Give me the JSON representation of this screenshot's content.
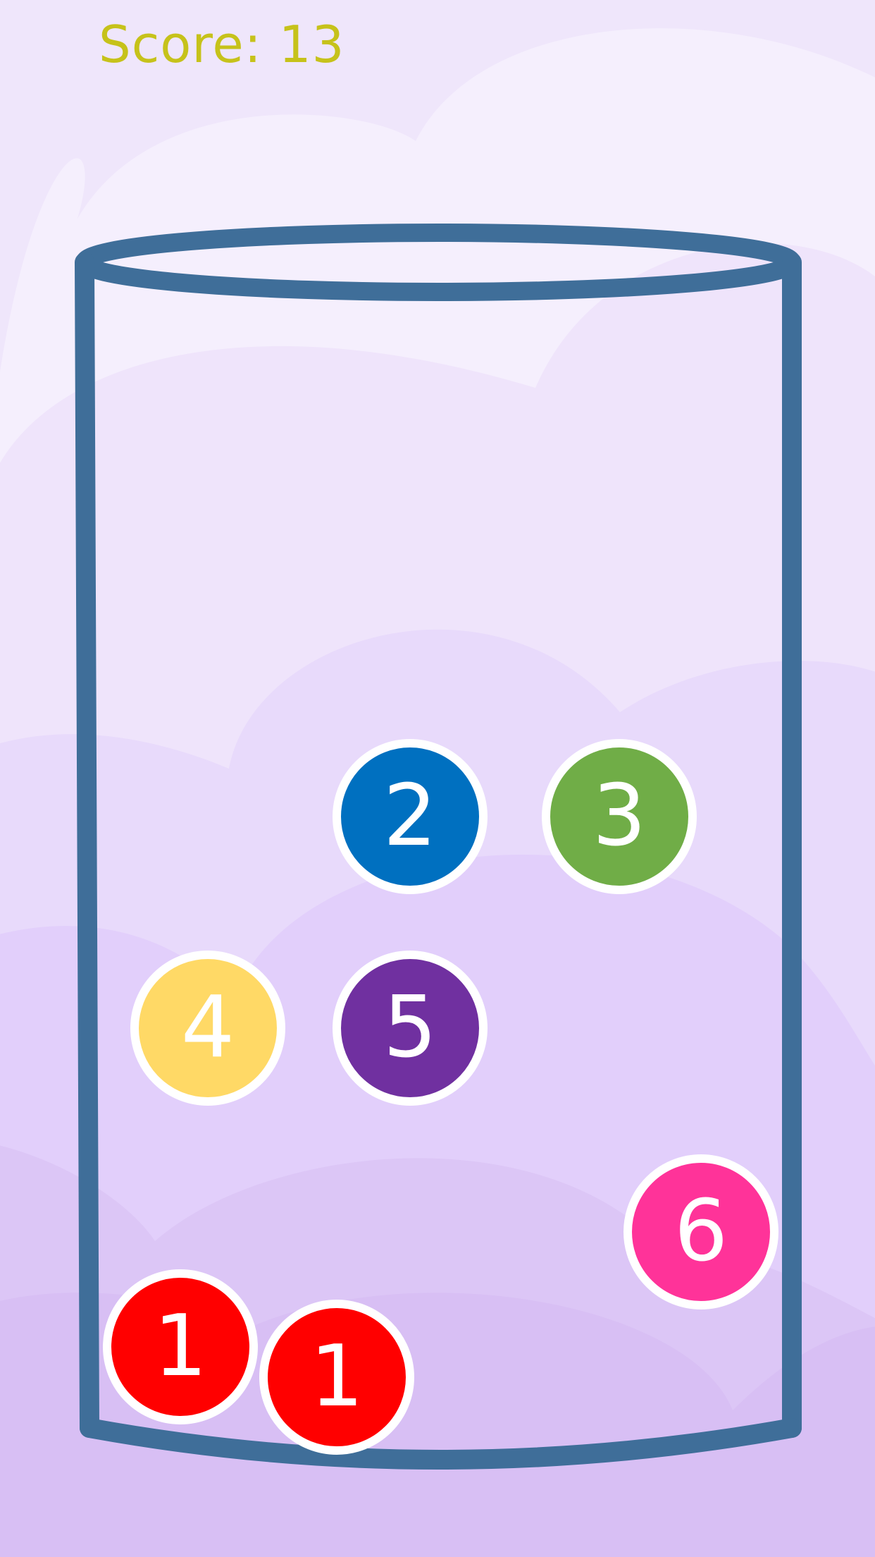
{
  "hud": {
    "score_label": "Score: 13"
  },
  "balls": [
    {
      "label": "2",
      "color": "#0070c0"
    },
    {
      "label": "3",
      "color": "#70ad47"
    },
    {
      "label": "4",
      "color": "#ffd966"
    },
    {
      "label": "5",
      "color": "#7030a0"
    },
    {
      "label": "6",
      "color": "#ff3399"
    },
    {
      "label": "1",
      "color": "#ff0000"
    },
    {
      "label": "1",
      "color": "#ff0000"
    }
  ],
  "theme": {
    "glass_color": "#3f6e99",
    "score_color": "#c6c21a",
    "background_colors": [
      "#efe6fb",
      "#f6effd",
      "#e6d6fb",
      "#dcc4f6"
    ]
  }
}
